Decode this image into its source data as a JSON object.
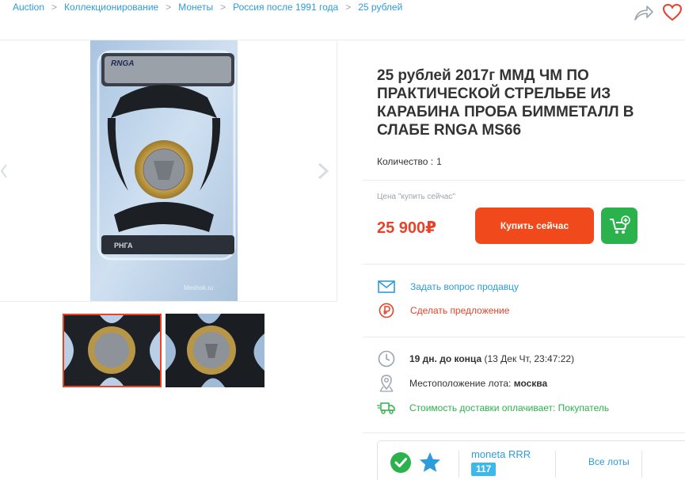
{
  "breadcrumb": [
    "Auction",
    "Коллекционирование",
    "Монеты",
    "Россия после 1991 года",
    "25 рублей"
  ],
  "breadcrumb_separator": ">",
  "photo": {
    "label_top": "RNGA",
    "label_bottom": "РНГА",
    "watermark": "Meshok.ru"
  },
  "lot": {
    "title": "25 рублей 2017г ММД ЧМ ПО ПРАКТИЧЕСКОЙ СТРЕЛЬБЕ ИЗ КАРАБИНА ПРОБА БИММЕТАЛЛ В СЛАБЕ RNGA MS66",
    "quantity_label": "Количество :",
    "quantity_value": "1",
    "price_caption": "Цена \"купить сейчас\"",
    "price": "25 900₽",
    "buy_label": "Купить сейчас"
  },
  "actions": {
    "ask_seller": "Задать вопрос продавцу",
    "make_offer": "Сделать предложение"
  },
  "info": {
    "time_left": "19 дн. до конца",
    "end_date": "(13 Дек Чт, 23:47:22)",
    "location_label": "Местоположение лота:",
    "location_value": "москва",
    "shipping": "Стоимость доставки оплачивает: Покупатель"
  },
  "seller": {
    "name": "moneta RRR",
    "rating": "117",
    "all_lots": "Все лоты"
  },
  "colors": {
    "link_blue": "#2d9cdb",
    "price_red": "#e6432a",
    "buy_orange": "#f0491b",
    "cart_green": "#2bb24c",
    "rating_blue": "#3db8ea"
  }
}
